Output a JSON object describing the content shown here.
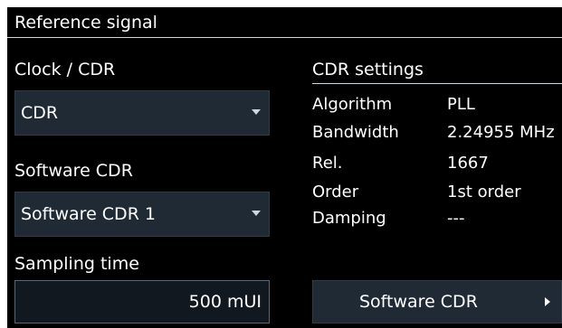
{
  "window": {
    "title": "Reference signal"
  },
  "left": {
    "clock_cdr": {
      "label": "Clock / CDR",
      "selected": "CDR",
      "icon": "chevron-down-icon"
    },
    "software_cdr": {
      "label": "Software CDR",
      "selected": "Software CDR 1",
      "icon": "chevron-down-icon"
    },
    "sampling_time": {
      "label": "Sampling time",
      "value": "500 mUI"
    }
  },
  "cdr_settings": {
    "title": "CDR settings",
    "rows": [
      {
        "key": "Algorithm",
        "value": "PLL"
      },
      {
        "key": "Bandwidth",
        "value": "2.24955 MHz"
      },
      {
        "key": "Rel.",
        "value": "1667"
      },
      {
        "key": "Order",
        "value": "1st order"
      },
      {
        "key": "Damping",
        "value": "---"
      }
    ]
  },
  "buttons": {
    "software_cdr": {
      "label": "Software CDR",
      "icon": "chevron-right-icon"
    }
  },
  "colors": {
    "background": "#000000",
    "control_bg": "#1f2a34",
    "separator": "#cfd6dc",
    "text": "#ffffff"
  }
}
